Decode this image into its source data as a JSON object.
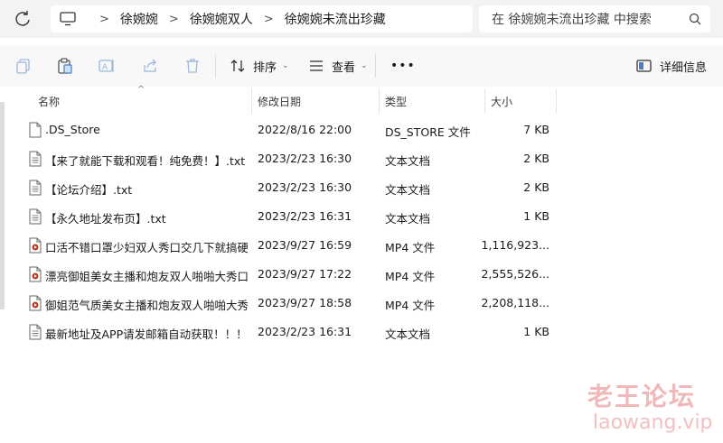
{
  "address_bar": {
    "breadcrumb": [
      "徐婉婉",
      "徐婉婉双人",
      "徐婉婉未流出珍藏"
    ],
    "search_placeholder": "在 徐婉婉未流出珍藏 中搜索"
  },
  "command_bar": {
    "sort_label": "排序",
    "view_label": "查看",
    "details_label": "详细信息",
    "more_label": "•••"
  },
  "columns": {
    "name": "名称",
    "date": "修改日期",
    "type": "类型",
    "size": "大小"
  },
  "files": [
    {
      "name": ".DS_Store",
      "date": "2022/8/16 22:00",
      "type": "DS_STORE 文件",
      "size": "7 KB",
      "icon": "file-icon"
    },
    {
      "name": "【来了就能下载和观看！纯免费！】.txt",
      "date": "2023/2/23 16:30",
      "type": "文本文档",
      "size": "2 KB",
      "icon": "text-file-icon"
    },
    {
      "name": "【论坛介绍】.txt",
      "date": "2023/2/23 16:30",
      "type": "文本文档",
      "size": "2 KB",
      "icon": "text-file-icon"
    },
    {
      "name": "【永久地址发布页】.txt",
      "date": "2023/2/23 16:31",
      "type": "文本文档",
      "size": "1 KB",
      "icon": "text-file-icon"
    },
    {
      "name": "口活不错口罩少妇双人秀口交几下就搞硬...",
      "date": "2023/9/27 16:59",
      "type": "MP4 文件",
      "size": "1,116,923...",
      "icon": "video-file-icon"
    },
    {
      "name": "漂亮御姐美女主播和炮友双人啪啪大秀口...",
      "date": "2023/9/27 17:22",
      "type": "MP4 文件",
      "size": "2,555,526...",
      "icon": "video-file-icon"
    },
    {
      "name": "御姐范气质美女主播和炮友双人啪啪大秀...",
      "date": "2023/9/27 18:58",
      "type": "MP4 文件",
      "size": "2,208,118...",
      "icon": "video-file-icon"
    },
    {
      "name": "最新地址及APP请发邮箱自动获取！！！...",
      "date": "2023/2/23 16:31",
      "type": "文本文档",
      "size": "1 KB",
      "icon": "text-file-icon"
    }
  ],
  "watermark": {
    "title": "老王论坛",
    "url": "laowang.vip"
  }
}
